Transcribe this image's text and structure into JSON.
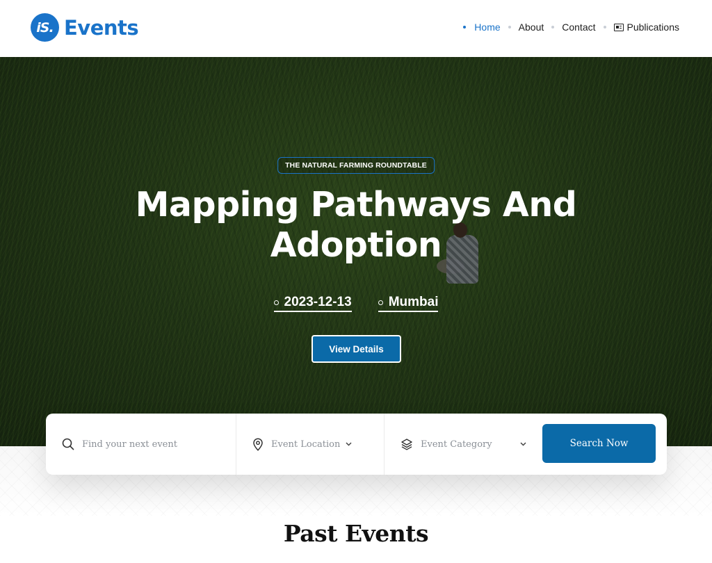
{
  "header": {
    "logo_badge": "iS.",
    "logo_text": "Events",
    "nav": [
      {
        "label": "Home",
        "active": true
      },
      {
        "label": "About",
        "active": false
      },
      {
        "label": "Contact",
        "active": false
      },
      {
        "label": "Publications",
        "active": false,
        "icon": "newspaper-icon"
      }
    ]
  },
  "hero": {
    "tag": "THE NATURAL FARMING ROUNDTABLE",
    "title_line1": "Mapping Pathways And",
    "title_line2": "Adoption",
    "date": "2023-12-13",
    "location": "Mumbai",
    "cta": "View Details"
  },
  "search": {
    "keyword_placeholder": "Find your next event",
    "location_placeholder": "Event Location",
    "category_placeholder": "Event Category",
    "button": "Search Now"
  },
  "section": {
    "title": "Past Events"
  },
  "colors": {
    "brand": "#1a73c9",
    "button": "#0b6aa8"
  }
}
